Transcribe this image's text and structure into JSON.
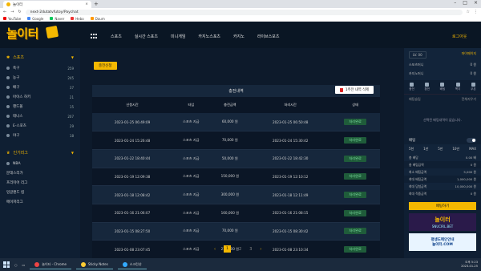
{
  "browser": {
    "tab_title": "놀이터",
    "url": "next-2dutatvfutoy/Paychat",
    "bookmarks": [
      "YouTube",
      "Google",
      "Naver",
      "Hebo",
      "Daum"
    ]
  },
  "site": {
    "logo": "놀이터",
    "nav": [
      "스포츠",
      "실시간 스포츠",
      "미니게임",
      "카지노스포츠",
      "카지노",
      "라이브스포츠"
    ],
    "login": "로그아웃"
  },
  "sidebar": {
    "sports_header": "스포츠",
    "sports": [
      {
        "name": "축구",
        "count": "259"
      },
      {
        "name": "농구",
        "count": "245"
      },
      {
        "name": "배구",
        "count": "37"
      },
      {
        "name": "아이스 하키",
        "count": "21"
      },
      {
        "name": "핸드볼",
        "count": "15"
      },
      {
        "name": "테니스",
        "count": "207"
      },
      {
        "name": "E-스포츠",
        "count": "29"
      },
      {
        "name": "야구",
        "count": "18"
      }
    ],
    "league_header": "인기리그",
    "leagues": [
      "NBA",
      "분데스리가",
      "프리미어 리그",
      "잉글랜드 컵",
      "메이저리그"
    ]
  },
  "main": {
    "charge_button": "충전신청",
    "panel_title": "충전내역",
    "delete_button": "1주전 내역 삭제",
    "columns": [
      "신청시간",
      "타입",
      "충전금액",
      "처리시간",
      "상태"
    ],
    "rows": [
      {
        "requested": "2023-01-25 06:49:09",
        "type": "스포츠 지급",
        "amount": "60,000 원",
        "processed": "2023-01-25 06:50:48",
        "status": "처리완료"
      },
      {
        "requested": "2023-01-24 15:26:48",
        "type": "스포츠 지급",
        "amount": "70,000 원",
        "processed": "2023-01-24 15:30:42",
        "status": "처리완료"
      },
      {
        "requested": "2023-01-22 18:40:44",
        "type": "스포츠 지급",
        "amount": "50,000 원",
        "processed": "2023-01-22 18:42:30",
        "status": "처리완료"
      },
      {
        "requested": "2023-01-19 12:09:38",
        "type": "스포츠 지급",
        "amount": "150,000 원",
        "processed": "2023-01-19 12:10:12",
        "status": "처리완료"
      },
      {
        "requested": "2023-01-18 12:08:42",
        "type": "스포츠 지급",
        "amount": "300,000 원",
        "processed": "2023-01-18 12:11:49",
        "status": "처리완료"
      },
      {
        "requested": "2023-01-16 21:06:07",
        "type": "스포츠 지급",
        "amount": "160,000 원",
        "processed": "2023-01-16 21:08:15",
        "status": "처리완료"
      },
      {
        "requested": "2023-01-15 08:27:50",
        "type": "스포츠 지급",
        "amount": "70,000 원",
        "processed": "2023-01-15 08:30:42",
        "status": "처리완료"
      },
      {
        "requested": "2023-01-08 23:07:45",
        "type": "스포츠 지급",
        "amount": "210,000 원",
        "processed": "2023-01-08 23:10:34",
        "status": "처리완료"
      }
    ],
    "pager": {
      "prev": "‹",
      "current": "1",
      "pages": [
        "2",
        "3"
      ],
      "next": "›"
    }
  },
  "right": {
    "level": "LV. 00",
    "mypage": "마이페이지",
    "sports_money_label": "스포츠머니",
    "sports_money": "0 원",
    "casino_money_label": "카지노머니",
    "casino_money": "0 원",
    "icons": [
      "충전",
      "환전",
      "베팅",
      "쪽지",
      "쿠폰"
    ],
    "bet_head_left": "배팅슬립",
    "bet_head_right": "전체지우기",
    "empty_msg": "선택된 배팅내역이 없습니다.",
    "slip_label": "배팅",
    "quick": [
      "5천",
      "1만",
      "5만",
      "10만",
      "MAX"
    ],
    "stats": [
      {
        "label": "총 배당",
        "value": "0.00 배"
      },
      {
        "label": "총 배팅금액",
        "value": "0 원"
      },
      {
        "label": "최소 배팅금액",
        "value": "5,000 원"
      },
      {
        "label": "최대 배팅금액",
        "value": "1,000,000 원"
      },
      {
        "label": "최대 당첨금액",
        "value": "10,000,000 원"
      },
      {
        "label": "최대 적중금액",
        "value": "0 원"
      }
    ],
    "bet_button": "배팅하기",
    "ad1_logo": "놀이터",
    "ad1_domain": "SNUCIRL.BET",
    "ad2_text": "평생도메인안내",
    "ad2_domain": "놀이터.COM"
  },
  "taskbar": {
    "items": [
      "놀이터 - Chrome",
      "Sticky Notes",
      "스크린샷"
    ],
    "time": "오후 5:23",
    "date": "2023-01-25"
  },
  "colors": {
    "accent": "#f5b800",
    "bg": "#0d1a2b",
    "panel": "#16273c",
    "status": "#1f5c3a"
  }
}
